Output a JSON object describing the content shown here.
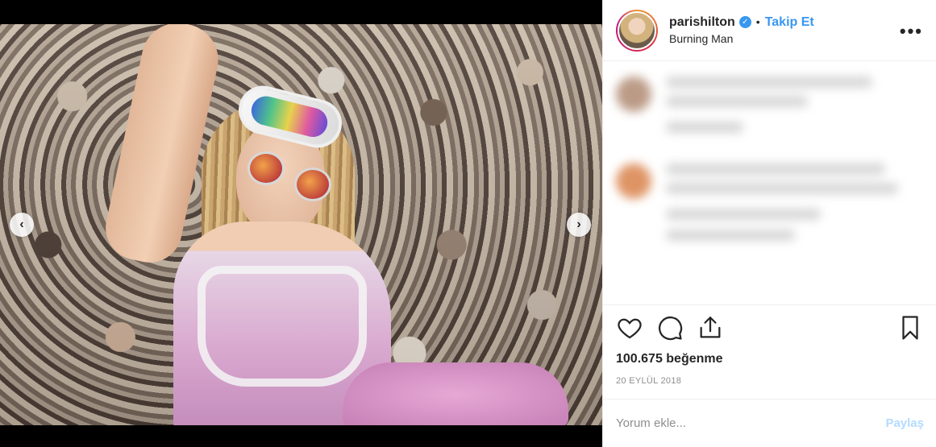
{
  "post": {
    "username": "parishilton",
    "verified_icon": "verified-badge-icon",
    "separator": "•",
    "follow_label": "Takip Et",
    "location": "Burning Man",
    "more_label": "•••",
    "likes": "100.675 beğenme",
    "date": "20 EYLÜL 2018"
  },
  "media": {
    "prev_label": "‹",
    "next_label": "›"
  },
  "comment_box": {
    "placeholder": "Yorum ekle...",
    "post_label": "Paylaş"
  },
  "icons": {
    "like": "heart-icon",
    "comment": "comment-bubble-icon",
    "share": "share-icon",
    "save": "bookmark-icon"
  },
  "colors": {
    "accent": "#3897f0",
    "post_disabled": "#b3dbff",
    "muted": "#8e8e8e",
    "text": "#262626"
  }
}
